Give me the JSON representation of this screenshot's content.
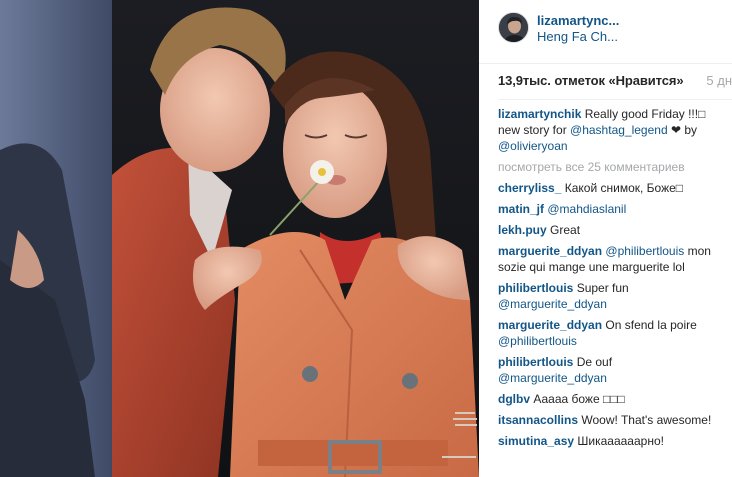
{
  "post": {
    "author": "lizamartync...",
    "location": "Heng Fa Ch...",
    "likes": "13,9тыс. отметок «Нравится»",
    "time": "5 дн"
  },
  "caption": {
    "user": "lizamartynchik",
    "text_1": "Really good Friday !!!□ new story for ",
    "tag": "@hashtag_legend",
    "heart": "❤",
    "text_2": " by ",
    "mention": "@olivieryoan"
  },
  "view_all": "посмотреть все 25 комментариев",
  "comments": [
    {
      "user": "cherryliss_",
      "text": "Какой снимок, Боже□"
    },
    {
      "user": "matin_jf",
      "mention": "@mahdiaslanil"
    },
    {
      "user": "lekh.puy",
      "text": "Great"
    },
    {
      "user": "marguerite_ddyan",
      "mention": "@philibertlouis",
      "text": " mon sozie qui mange une marguerite lol"
    },
    {
      "user": "philibertlouis",
      "text": "Super fun ",
      "mention": "@marguerite_ddyan"
    },
    {
      "user": "marguerite_ddyan",
      "text": "On sfend la poire ",
      "mention": "@philibertlouis"
    },
    {
      "user": "philibertlouis",
      "text": "De ouf ",
      "mention": "@marguerite_ddyan"
    },
    {
      "user": "dglbv",
      "text": "Ааааа боже □□□"
    },
    {
      "user": "itsannacollins",
      "text": "Woow! That's awesome!"
    },
    {
      "user": "simutina_asy",
      "text": "Шикаааааарно!"
    }
  ],
  "colors": {
    "link": "#125688",
    "text": "#262626",
    "muted": "#a5a7aa",
    "coat": "#d97a52",
    "jacket": "#b8452f"
  },
  "photo": {
    "description_icon": "fashion-photo-image"
  }
}
